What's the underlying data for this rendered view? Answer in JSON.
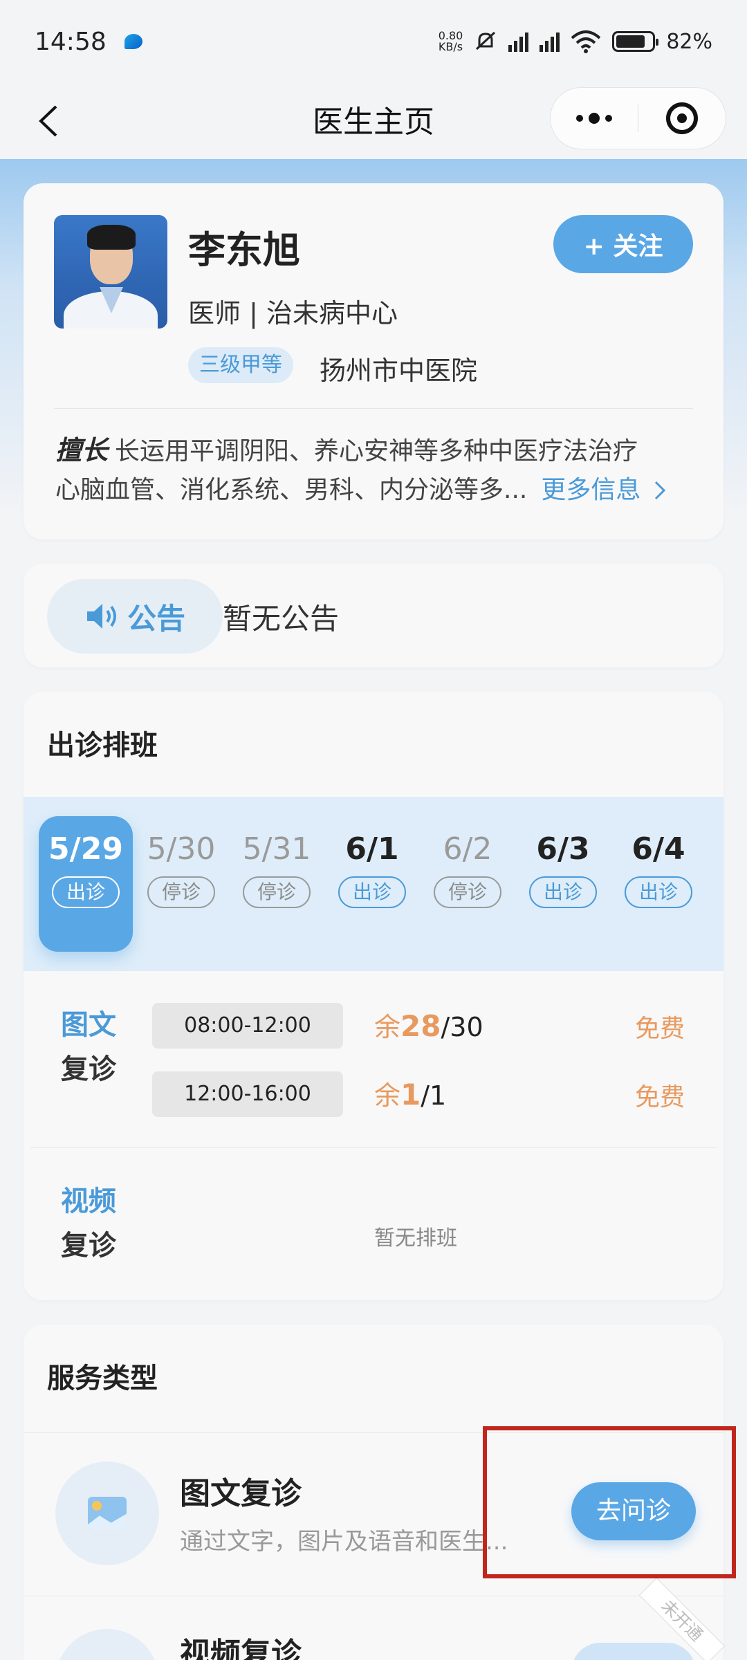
{
  "status": {
    "time": "14:58",
    "speed_value": "0.80",
    "speed_unit": "KB/s",
    "battery_percent": 82,
    "battery_text": "82%"
  },
  "nav": {
    "title": "医生主页"
  },
  "doctor": {
    "name": "李东旭",
    "title": "医师 | 治未病中心",
    "level": "三级甲等",
    "hospital": "扬州市中医院",
    "follow_label": "+ 关注",
    "specialty_label": "擅长",
    "specialty_line1": "长运用平调阴阳、养心安神等多种中医疗法治疗",
    "specialty_line2": "心脑血管、消化系统、男科、内分泌等多...",
    "more_info": "更多信息"
  },
  "notice": {
    "label": "公告",
    "text": "暂无公告"
  },
  "schedule": {
    "title": "出诊排班",
    "dates": [
      {
        "date": "5/29",
        "status": "出诊",
        "active": true
      },
      {
        "date": "5/30",
        "status": "停诊",
        "active": false
      },
      {
        "date": "5/31",
        "status": "停诊",
        "active": false
      },
      {
        "date": "6/1",
        "status": "出诊",
        "active": false
      },
      {
        "date": "6/2",
        "status": "停诊",
        "active": false
      },
      {
        "date": "6/3",
        "status": "出诊",
        "active": false
      },
      {
        "date": "6/4",
        "status": "出诊",
        "active": false
      }
    ],
    "text_consult": {
      "label_top": "图文",
      "label_bottom": "复诊",
      "slots": [
        {
          "time": "08:00-12:00",
          "remain_prefix": "余",
          "remain": "28",
          "total": "/30",
          "price": "免费"
        },
        {
          "time": "12:00-16:00",
          "remain_prefix": "余",
          "remain": "1",
          "total": "/1",
          "price": "免费"
        }
      ]
    },
    "video_consult": {
      "label_top": "视频",
      "label_bottom": "复诊",
      "empty_text": "暂无排班"
    }
  },
  "services": {
    "title": "服务类型",
    "items": [
      {
        "name": "图文复诊",
        "desc": "通过文字，图片及语音和医生...",
        "button": "去问诊",
        "icon": "image-chat-icon"
      },
      {
        "name": "视频复诊",
        "desc": "",
        "button": "去问诊",
        "icon": "video-icon",
        "badge": "未开通"
      }
    ]
  },
  "colors": {
    "accent": "#5aa7e6",
    "accent_text": "#4a9ad8",
    "price": "#e89a5e",
    "highlight": "#c0271c"
  }
}
